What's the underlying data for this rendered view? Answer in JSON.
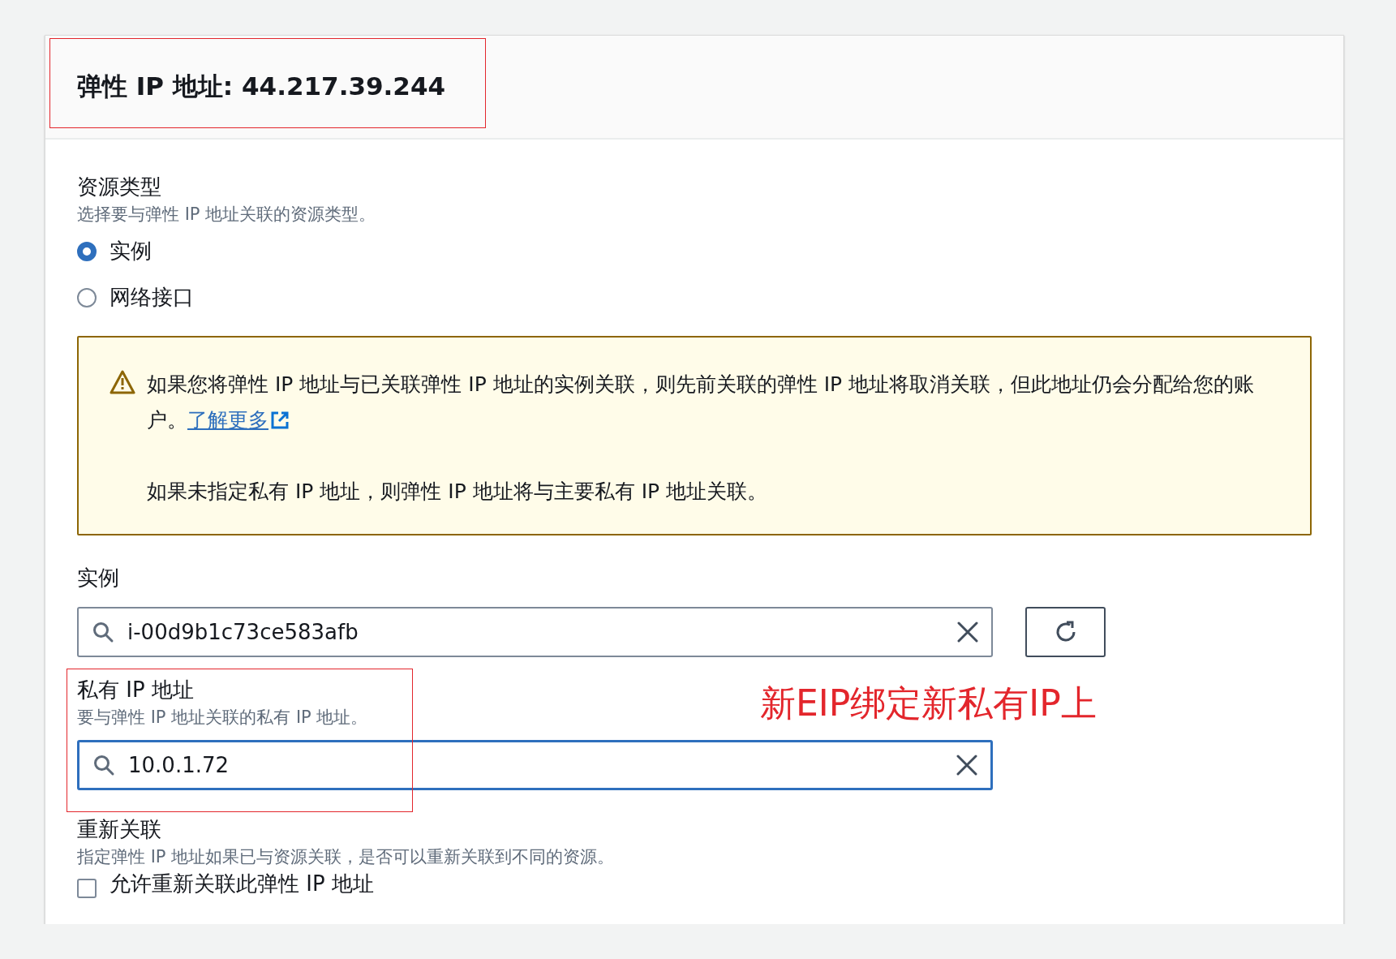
{
  "header": {
    "title": "弹性 IP 地址: 44.217.39.244"
  },
  "resource_type": {
    "label": "资源类型",
    "description": "选择要与弹性 IP 地址关联的资源类型。",
    "options": [
      {
        "label": "实例",
        "selected": true
      },
      {
        "label": "网络接口",
        "selected": false
      }
    ]
  },
  "alert": {
    "paragraphs": [
      {
        "text": "如果您将弹性 IP 地址与已关联弹性 IP 地址的实例关联，则先前关联的弹性 IP 地址将取消关联，但此地址仍会分配给您的账户。",
        "link": "了解更多"
      },
      {
        "text": "如果未指定私有 IP 地址，则弹性 IP 地址将与主要私有 IP 地址关联。"
      }
    ]
  },
  "instance": {
    "label": "实例",
    "value": "i-00d9b1c73ce583afb",
    "focused": false
  },
  "private_ip": {
    "label": "私有 IP 地址",
    "description": "要与弹性 IP 地址关联的私有 IP 地址。",
    "value": "10.0.1.72",
    "focused": true
  },
  "annotation": {
    "text": "新EIP绑定新私有IP上"
  },
  "reassociation": {
    "label": "重新关联",
    "description": "指定弹性 IP 地址如果已与资源关联，是否可以重新关联到不同的资源。",
    "checkbox": {
      "label": "允许重新关联此弹性 IP 地址",
      "checked": false
    }
  }
}
